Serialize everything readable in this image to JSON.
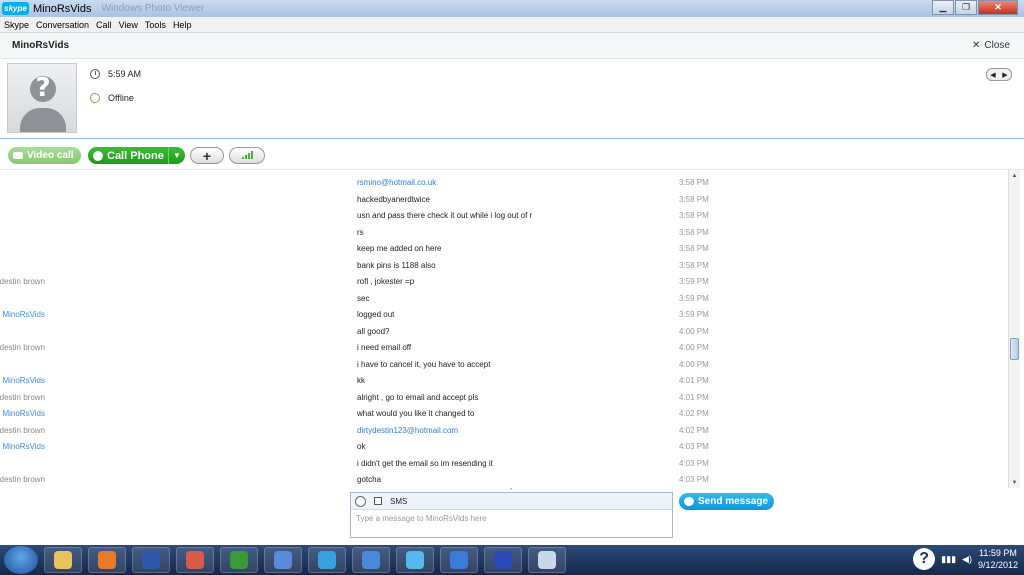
{
  "window": {
    "title": "MinoRsVids",
    "background_title": "Windows Photo Viewer"
  },
  "menu": [
    "Skype",
    "Conversation",
    "Call",
    "View",
    "Tools",
    "Help"
  ],
  "contact": {
    "name": "MinoRsVids",
    "close_label": "Close",
    "local_time": "5:59 AM",
    "status": "Offline"
  },
  "actions": {
    "video_call": "Video call",
    "call_phone": "Call Phone",
    "add": "+"
  },
  "messages": [
    {
      "sender": "",
      "text": "rsmino@hotmail.co.uk",
      "time": "3:58 PM",
      "link": true
    },
    {
      "sender": "",
      "text": "hackedbyanerdtwice",
      "time": "3:58 PM"
    },
    {
      "sender": "",
      "text": "usn and pass there check it out while i log out of r",
      "time": "3:58 PM"
    },
    {
      "sender": "",
      "text": "rs",
      "time": "3:58 PM"
    },
    {
      "sender": "",
      "text": "keep me added on here",
      "time": "3:58 PM"
    },
    {
      "sender": "",
      "text": "bank pins is 1188 also",
      "time": "3:58 PM"
    },
    {
      "sender": "destin brown",
      "text": "rofl , jokester =p",
      "time": "3:59 PM"
    },
    {
      "sender": "",
      "text": "sec",
      "time": "3:59 PM"
    },
    {
      "sender": "MinoRsVids",
      "text": "logged out",
      "time": "3:59 PM",
      "me": true
    },
    {
      "sender": "",
      "text": "all good?",
      "time": "4:00 PM"
    },
    {
      "sender": "destin brown",
      "text": "i need email off",
      "time": "4:00 PM"
    },
    {
      "sender": "",
      "text": "i have to cancel it, you have to accept",
      "time": "4:00 PM"
    },
    {
      "sender": "MinoRsVids",
      "text": "kk",
      "time": "4:01 PM",
      "me": true
    },
    {
      "sender": "destin brown",
      "text": "alright , go to email and accept pls",
      "time": "4:01 PM"
    },
    {
      "sender": "MinoRsVids",
      "text": "what would you like it changed to",
      "time": "4:02 PM",
      "me": true
    },
    {
      "sender": "destin brown",
      "text": "dirtydestin123@hotmail.com",
      "time": "4:02 PM",
      "link": true
    },
    {
      "sender": "MinoRsVids",
      "text": "ok",
      "time": "4:03 PM",
      "me": true
    },
    {
      "sender": "",
      "text": "i didn't get the email so im resending it",
      "time": "4:03 PM"
    },
    {
      "sender": "destin brown",
      "text": "gotcha",
      "time": "4:03 PM"
    }
  ],
  "composer": {
    "sms_label": "SMS",
    "placeholder": "Type a message to MinoRsVids here",
    "send_label": "Send message"
  },
  "taskbar": {
    "clock_time": "11:59 PM",
    "clock_date": "9/12/2012",
    "app_colors": [
      "#e8c25a",
      "#e87b2a",
      "#2a5aa8",
      "#d85a4a",
      "#3a9a3a",
      "#5a8ad8",
      "#3aa0e0",
      "#4a8ad8",
      "#5ab8f0",
      "#3a7ad8",
      "#2a4ab8",
      "#c8d8e8"
    ]
  },
  "colors": {
    "accent": "#00aff0",
    "call_green": "#1e9a1a",
    "link": "#2a7ed8"
  }
}
